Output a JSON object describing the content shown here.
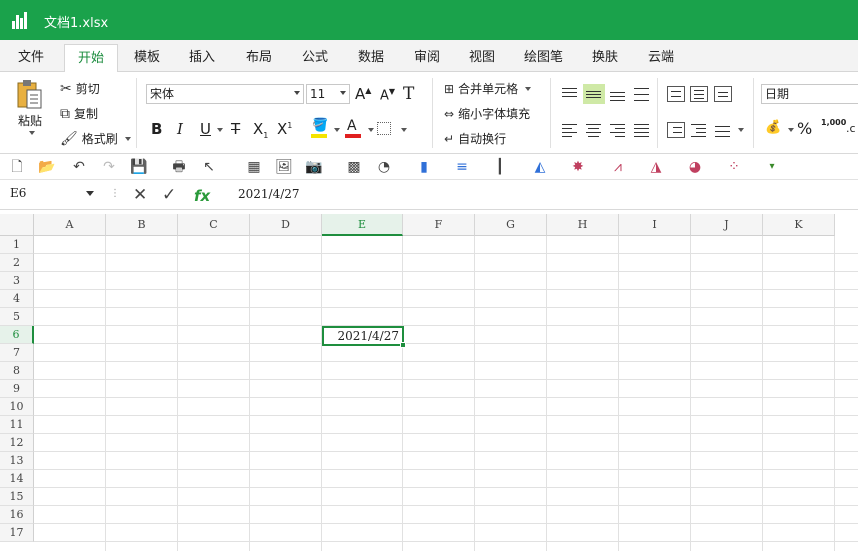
{
  "window": {
    "title": "文档1.xlsx"
  },
  "menu": {
    "tabs": [
      {
        "label": "文件"
      },
      {
        "label": "开始"
      },
      {
        "label": "模板"
      },
      {
        "label": "插入"
      },
      {
        "label": "布局"
      },
      {
        "label": "公式"
      },
      {
        "label": "数据"
      },
      {
        "label": "审阅"
      },
      {
        "label": "视图"
      },
      {
        "label": "绘图笔"
      },
      {
        "label": "换肤"
      },
      {
        "label": "云端"
      }
    ],
    "active": "开始"
  },
  "ribbon": {
    "paste_label": "粘贴",
    "cut_label": "剪切",
    "copy_label": "复制",
    "format_painter_label": "格式刷",
    "font_name": "宋体",
    "font_size": "11",
    "merge_label": "合并单元格",
    "shrink_label": "缩小字体填充",
    "wrap_label": "自动换行",
    "number_format": "日期",
    "percent_label": "%",
    "thousands_label": "1,000"
  },
  "formula_bar": {
    "cell_ref": "E6",
    "value": "2021/4/27",
    "fx_label": "fx"
  },
  "grid": {
    "columns": [
      "A",
      "B",
      "C",
      "D",
      "E",
      "F",
      "G",
      "H",
      "I",
      "J",
      "K"
    ],
    "rows": [
      "1",
      "2",
      "3",
      "4",
      "5",
      "6",
      "7",
      "8",
      "9",
      "10",
      "11",
      "12",
      "13",
      "14",
      "15",
      "16",
      "17"
    ],
    "selected_column": "E",
    "selected_row": "6",
    "active_cell_value": "2021/4/27"
  },
  "colors": {
    "title_bar": "#1aa24b",
    "accent": "#1e8e3e",
    "font_color_underline": "#e02020",
    "fill_color_underline": "#f5e400"
  }
}
